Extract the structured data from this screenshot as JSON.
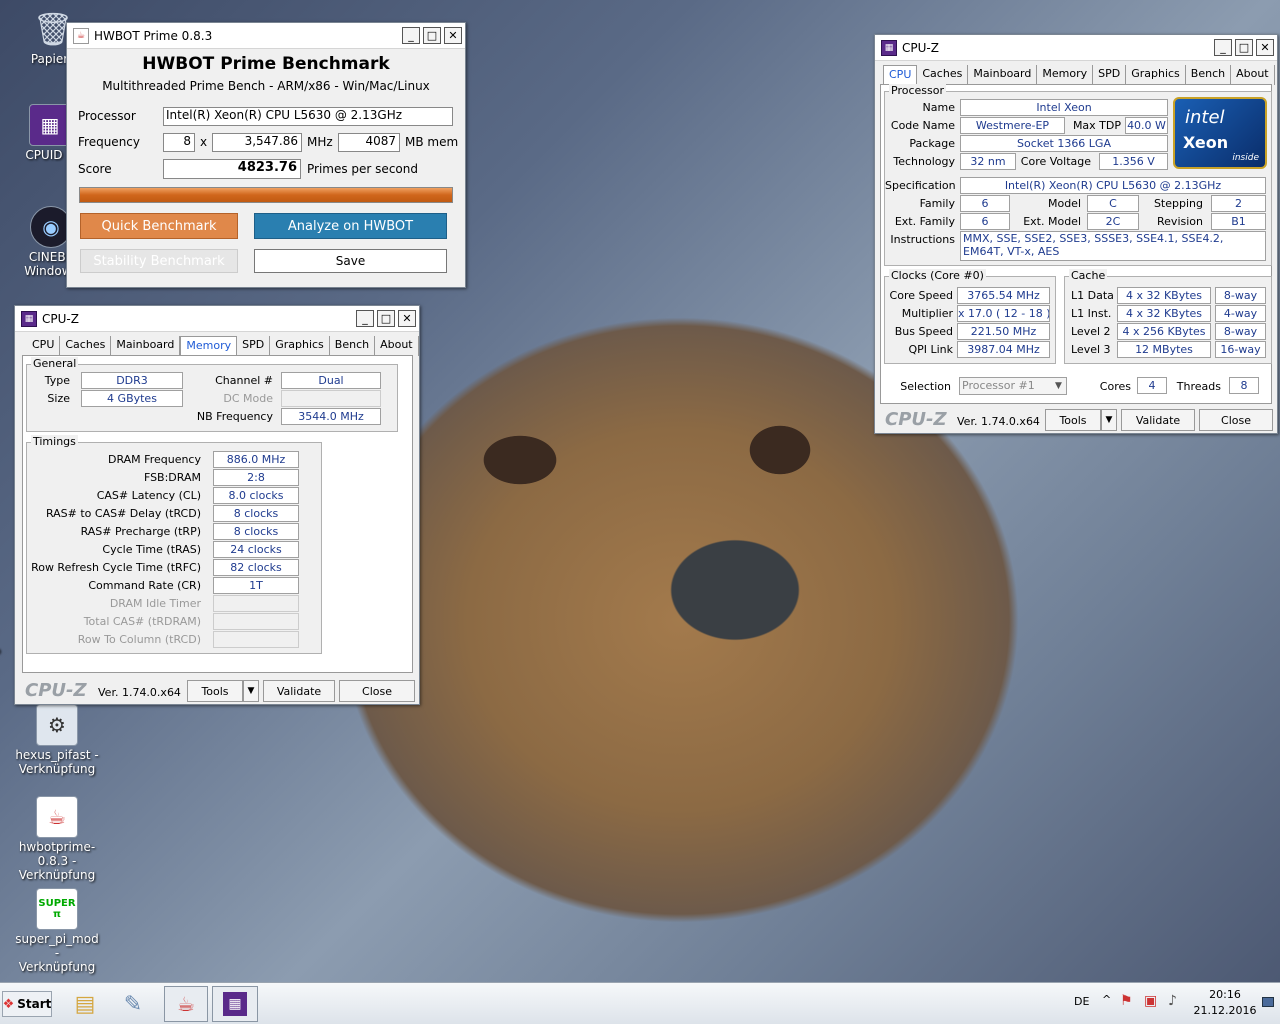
{
  "desktop": {
    "icons": [
      {
        "label": "Papierk",
        "ico": "🗑"
      },
      {
        "label": "CPUID C",
        "ico": "▦"
      },
      {
        "label": "CINEBE",
        "label2": "Windows",
        "ico": "◉"
      },
      {
        "label": "GP",
        "ico": ""
      },
      {
        "label": "hexus_pifast -",
        "label2": "Verknüpfung",
        "ico": "⚙"
      },
      {
        "label": "hwbotprime-0.8.3 -",
        "label2": "Verknüpfung",
        "ico": "☕"
      },
      {
        "label": "super_pi_mod -",
        "label2": "Verknüpfung",
        "ico": "SUPER π"
      }
    ]
  },
  "hwbot": {
    "title": "HWBOT Prime 0.8.3",
    "heading": "HWBOT Prime Benchmark",
    "subheading": "Multithreaded Prime Bench - ARM/x86 - Win/Mac/Linux",
    "processor_label": "Processor",
    "processor_value": "Intel(R) Xeon(R) CPU        L5630  @ 2.13GHz",
    "frequency_label": "Frequency",
    "freq_mult": "8",
    "x_sep": "x",
    "freq_mhz": "3,547.86",
    "mhz_unit": "MHz",
    "mem_value": "4087",
    "mem_unit": "MB mem",
    "score_label": "Score",
    "score_value": "4823.76",
    "score_unit": "Primes per second",
    "progress": 1.0,
    "quick_btn": "Quick Benchmark",
    "analyze_btn": "Analyze on HWBOT",
    "stability_btn": "Stability Benchmark",
    "save_btn": "Save",
    "colors": {
      "orange": "#e0884a",
      "blue": "#2a7fb0"
    }
  },
  "cpuz_mem": {
    "title": "CPU-Z",
    "tabs": [
      "CPU",
      "Caches",
      "Mainboard",
      "Memory",
      "SPD",
      "Graphics",
      "Bench",
      "About"
    ],
    "active_tab": "Memory",
    "general_title": "General",
    "type_label": "Type",
    "type_value": "DDR3",
    "size_label": "Size",
    "size_value": "4 GBytes",
    "channel_label": "Channel #",
    "channel_value": "Dual",
    "dcmode_label": "DC Mode",
    "dcmode_value": "",
    "nbfreq_label": "NB Frequency",
    "nbfreq_value": "3544.0 MHz",
    "timings_title": "Timings",
    "timings": [
      {
        "label": "DRAM Frequency",
        "value": "886.0 MHz",
        "dim": false
      },
      {
        "label": "FSB:DRAM",
        "value": "2:8",
        "dim": false
      },
      {
        "label": "CAS# Latency (CL)",
        "value": "8.0 clocks",
        "dim": false
      },
      {
        "label": "RAS# to CAS# Delay (tRCD)",
        "value": "8 clocks",
        "dim": false
      },
      {
        "label": "RAS# Precharge (tRP)",
        "value": "8 clocks",
        "dim": false
      },
      {
        "label": "Cycle Time (tRAS)",
        "value": "24 clocks",
        "dim": false
      },
      {
        "label": "Row Refresh Cycle Time (tRFC)",
        "value": "82 clocks",
        "dim": false
      },
      {
        "label": "Command Rate (CR)",
        "value": "1T",
        "dim": false
      },
      {
        "label": "DRAM Idle Timer",
        "value": "",
        "dim": true
      },
      {
        "label": "Total CAS# (tRDRAM)",
        "value": "",
        "dim": true
      },
      {
        "label": "Row To Column (tRCD)",
        "value": "",
        "dim": true
      }
    ],
    "logo": "CPU-Z",
    "version": "Ver. 1.74.0.x64",
    "tools_btn": "Tools",
    "validate_btn": "Validate",
    "close_btn": "Close"
  },
  "cpuz_cpu": {
    "title": "CPU-Z",
    "tabs": [
      "CPU",
      "Caches",
      "Mainboard",
      "Memory",
      "SPD",
      "Graphics",
      "Bench",
      "About"
    ],
    "active_tab": "CPU",
    "processor_title": "Processor",
    "name_label": "Name",
    "name_value": "Intel Xeon",
    "codename_label": "Code Name",
    "codename_value": "Westmere-EP",
    "maxtdp_label": "Max TDP",
    "maxtdp_value": "40.0 W",
    "package_label": "Package",
    "package_value": "Socket 1366 LGA",
    "technology_label": "Technology",
    "technology_value": "32 nm",
    "corevoltage_label": "Core Voltage",
    "corevoltage_value": "1.356 V",
    "spec_label": "Specification",
    "spec_value": "Intel(R) Xeon(R) CPU        L5630  @ 2.13GHz",
    "family_label": "Family",
    "family_value": "6",
    "model_label": "Model",
    "model_value": "C",
    "stepping_label": "Stepping",
    "stepping_value": "2",
    "extfamily_label": "Ext. Family",
    "extfamily_value": "6",
    "extmodel_label": "Ext. Model",
    "extmodel_value": "2C",
    "revision_label": "Revision",
    "revision_value": "B1",
    "instructions_label": "Instructions",
    "instructions_value": "MMX, SSE, SSE2, SSE3, SSSE3, SSE4.1, SSE4.2, EM64T, VT-x, AES",
    "intel_logo": {
      "brand": "intel",
      "product": "Xeon",
      "tag": "inside"
    },
    "clocks_title": "Clocks (Core #0)",
    "corespeed_label": "Core Speed",
    "corespeed_value": "3765.54 MHz",
    "multiplier_label": "Multiplier",
    "multiplier_value": "x 17.0 ( 12 - 18 )",
    "busspeed_label": "Bus Speed",
    "busspeed_value": "221.50 MHz",
    "qpi_label": "QPI Link",
    "qpi_value": "3987.04 MHz",
    "cache_title": "Cache",
    "cache": [
      {
        "label": "L1 Data",
        "size": "4 x 32 KBytes",
        "way": "8-way"
      },
      {
        "label": "L1 Inst.",
        "size": "4 x 32 KBytes",
        "way": "4-way"
      },
      {
        "label": "Level 2",
        "size": "4 x 256 KBytes",
        "way": "8-way"
      },
      {
        "label": "Level 3",
        "size": "12 MBytes",
        "way": "16-way"
      }
    ],
    "selection_label": "Selection",
    "selection_value": "Processor #1",
    "cores_label": "Cores",
    "cores_value": "4",
    "threads_label": "Threads",
    "threads_value": "8",
    "logo": "CPU-Z",
    "version": "Ver. 1.74.0.x64",
    "tools_btn": "Tools",
    "validate_btn": "Validate",
    "close_btn": "Close"
  },
  "taskbar": {
    "start": "Start",
    "lang": "DE",
    "time": "20:16",
    "date": "21.12.2016"
  }
}
